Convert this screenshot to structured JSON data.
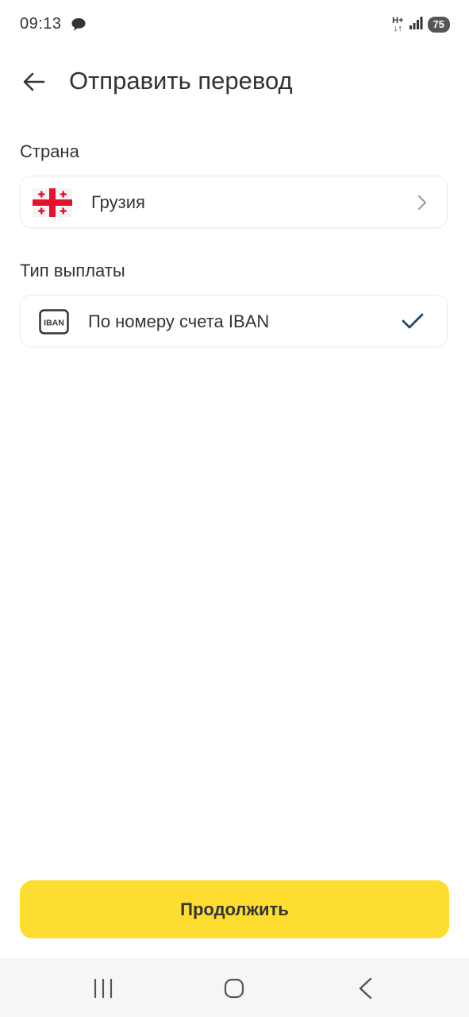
{
  "status_bar": {
    "time": "09:13",
    "network_type": "H+",
    "battery": "75"
  },
  "header": {
    "title": "Отправить перевод"
  },
  "country_section": {
    "label": "Страна",
    "selected_country": "Грузия",
    "flag_icon": "georgia-flag"
  },
  "payout_section": {
    "label": "Тип выплаты",
    "option_label": "По номеру счета IBAN",
    "option_icon_text": "IBAN",
    "selected": true
  },
  "footer": {
    "continue_label": "Продолжить"
  },
  "colors": {
    "accent": "#fddd2f",
    "check": "#1d4a6e",
    "flag_red": "#e8112d",
    "text": "#333333"
  }
}
